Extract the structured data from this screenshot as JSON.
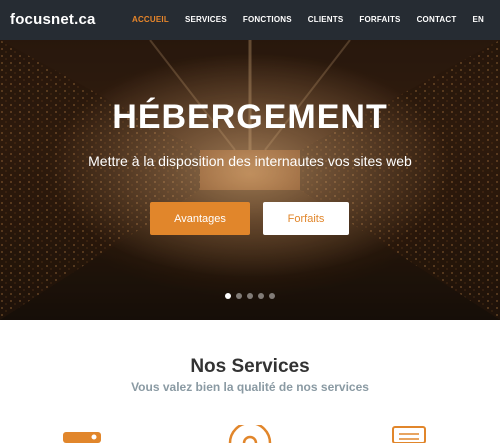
{
  "brand": {
    "logo": "focusnet.ca",
    "accent": "#e1862b",
    "nav_bg": "#262c33"
  },
  "nav": {
    "items": [
      {
        "label": "ACCUEIL",
        "active": true
      },
      {
        "label": "SERVICES",
        "active": false
      },
      {
        "label": "FONCTIONS",
        "active": false
      },
      {
        "label": "CLIENTS",
        "active": false
      },
      {
        "label": "FORFAITS",
        "active": false
      },
      {
        "label": "CONTACT",
        "active": false
      },
      {
        "label": "EN",
        "active": false
      }
    ]
  },
  "hero": {
    "title": "HÉBERGEMENT",
    "subtitle": "Mettre à la disposition des internautes vos sites web",
    "primary_button": "Avantages",
    "secondary_button": "Forfaits",
    "slide_count": 5,
    "active_slide": 1
  },
  "services": {
    "title": "Nos Services",
    "subtitle": "Vous valez bien la qualité de nos services",
    "icons": [
      "server-icon",
      "support-icon",
      "document-icon"
    ]
  }
}
